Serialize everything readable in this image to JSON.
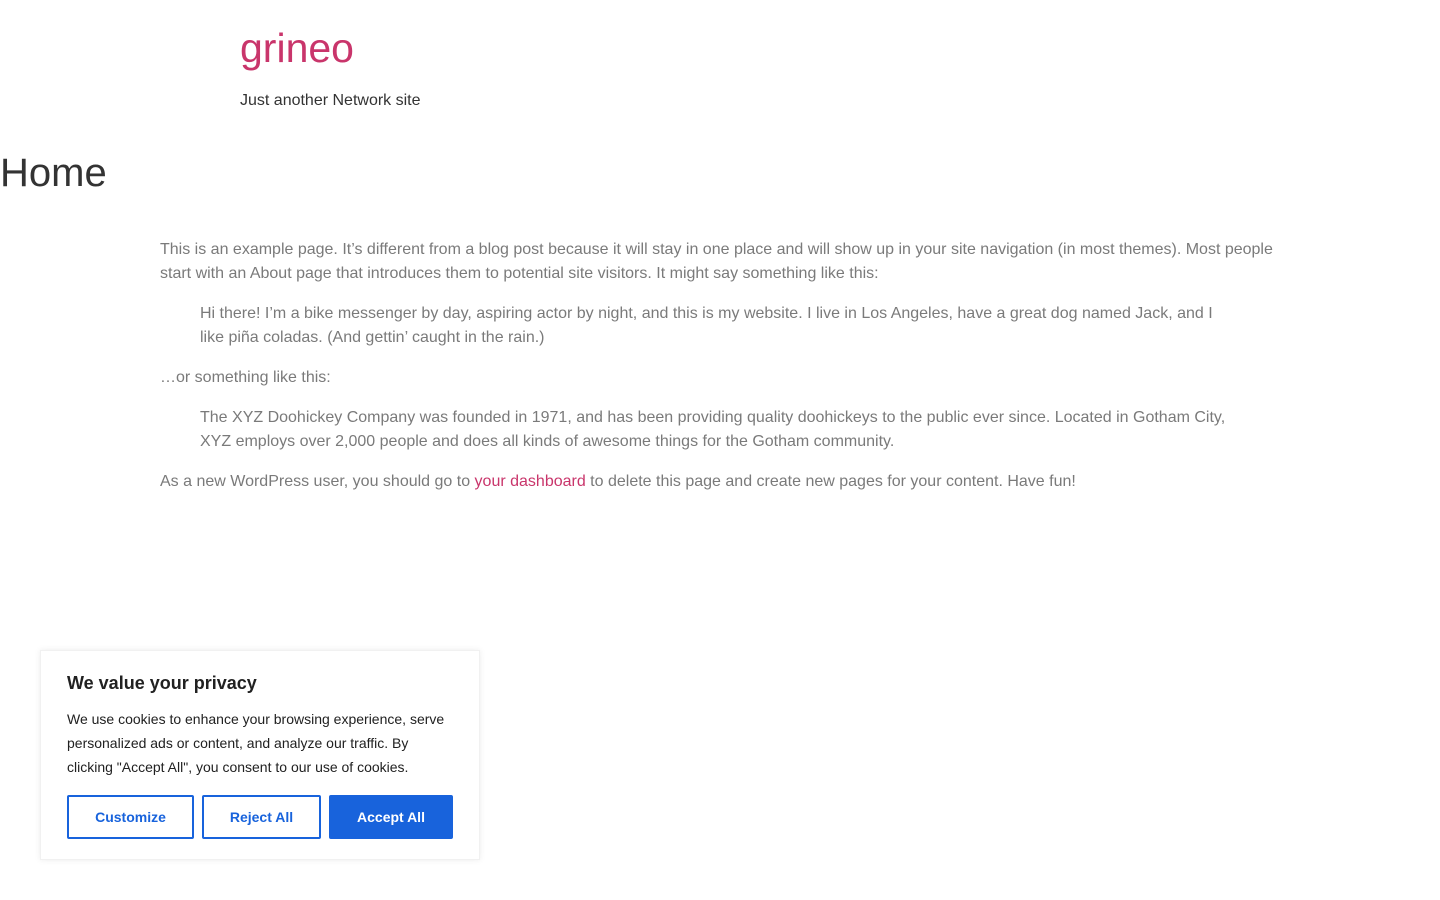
{
  "header": {
    "site_title": "grineo",
    "tagline": "Just another Network site"
  },
  "page": {
    "title": "Home",
    "intro": "This is an example page. It’s different from a blog post because it will stay in one place and will show up in your site navigation (in most themes). Most people start with an About page that introduces them to potential site visitors. It might say something like this:",
    "quote1": "Hi there! I’m a bike messenger by day, aspiring actor by night, and this is my website. I live in Los Angeles, have a great dog named Jack, and I like piña coladas. (And gettin’ caught in the rain.)",
    "middle": "…or something like this:",
    "quote2": "The XYZ Doohickey Company was founded in 1971, and has been providing quality doohickeys to the public ever since. Located in Gotham City, XYZ employs over 2,000 people and does all kinds of awesome things for the Gotham community.",
    "outro_before": "As a new WordPress user, you should go to ",
    "outro_link": "your dashboard",
    "outro_after": " to delete this page and create new pages for your content. Have fun!"
  },
  "cookie_banner": {
    "title": "We value your privacy",
    "text": "We use cookies to enhance your browsing experience, serve personalized ads or content, and analyze our traffic. By clicking \"Accept All\", you consent to our use of cookies.",
    "customize_label": "Customize",
    "reject_label": "Reject All",
    "accept_label": "Accept All"
  },
  "colors": {
    "brand": "#c9356b",
    "text_muted": "#7a7a7a",
    "cookie_accent": "#1863dc"
  }
}
